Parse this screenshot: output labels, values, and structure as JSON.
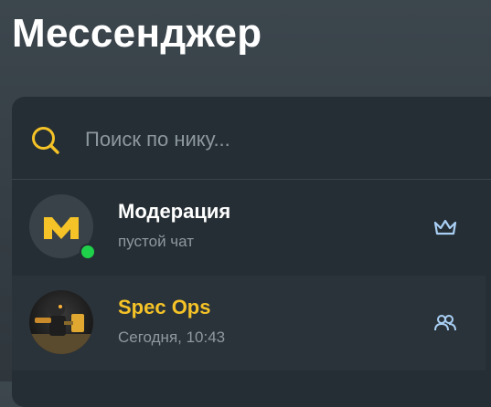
{
  "page": {
    "title": "Мессенджер"
  },
  "search": {
    "placeholder": "Поиск по нику..."
  },
  "chats": [
    {
      "name": "Модерация",
      "subtitle": "пустой чат",
      "online": true,
      "badge_icon": "crown-icon",
      "avatar_icon": "m-logo-icon",
      "name_color": "#ffffff"
    },
    {
      "name": "Spec Ops",
      "subtitle": "Сегодня, 10:43",
      "online": false,
      "badge_icon": "group-icon",
      "avatar_icon": "spec-ops-avatar",
      "name_color": "#f5c327"
    }
  ],
  "colors": {
    "accent": "#f5c327",
    "online": "#1fd14a",
    "badge": "#a9cff5"
  }
}
